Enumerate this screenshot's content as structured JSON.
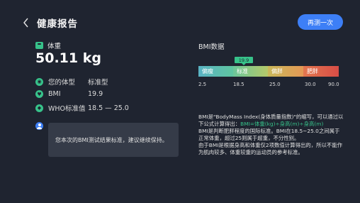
{
  "header": {
    "title": "健康报告",
    "retest_label": "再测一次"
  },
  "weight": {
    "label": "体重",
    "value": "50.11 kg"
  },
  "body_info": [
    {
      "label": "您的体型",
      "value": "标准型"
    },
    {
      "label": "BMI",
      "value": "19.9"
    },
    {
      "label": "WHO标准值",
      "value": "18.5 — 25.0"
    }
  ],
  "message": "您本次的BMI测试结果标准，建议继续保持。",
  "bmi_panel": {
    "title": "BMI数据",
    "marker_value": "19.9",
    "segments": [
      "偏瘦",
      "标准",
      "偏胖",
      "肥胖"
    ],
    "ticks": [
      "2.5",
      "18.5",
      "25.0",
      "30.0",
      "90.0"
    ]
  },
  "description": {
    "line1": "BMI是\"BodyMass Index(身体质量指数)\"的缩写，可以通过以下公式计算得出：",
    "formula": "BMI=体重(kg)÷身高(m)÷身高(m)",
    "line2": "BMI是判断肥胖程度的国际标准。BMI在18.5~25.0之间属于正常体重，超过25则属于超重，不分性别。",
    "line3": "由于BMI是根据身高和体重仅2项数值计算得出的，所以不能作为肌肉较多、体重较重的运动员的参考标准。"
  },
  "colors": {
    "background": "#1f2430",
    "accent_blue": "#3d7ff6",
    "accent_green": "#37c28a",
    "card": "#353b48"
  }
}
